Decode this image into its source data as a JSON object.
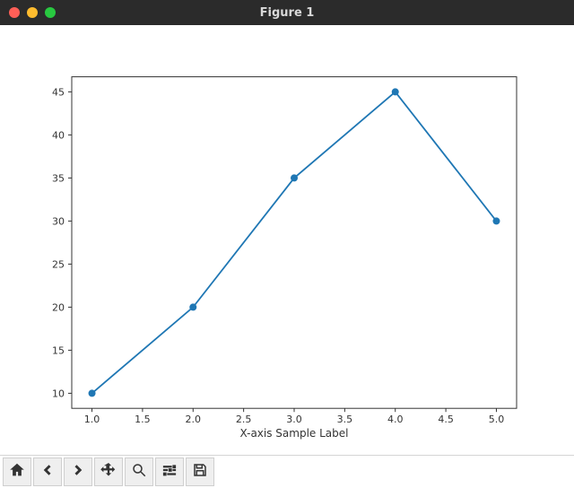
{
  "window": {
    "title": "Figure 1"
  },
  "toolbar": {
    "home": "Home",
    "back": "Back",
    "forward": "Forward",
    "pan": "Pan",
    "zoom": "Zoom",
    "config": "Configure subplots",
    "save": "Save"
  },
  "chart_data": {
    "type": "line",
    "x": [
      1.0,
      2.0,
      3.0,
      4.0,
      5.0
    ],
    "y": [
      10,
      20,
      35,
      45,
      30
    ],
    "xlabel": "X-axis Sample Label",
    "ylabel": "",
    "title": "",
    "xlim": [
      0.8,
      5.2
    ],
    "ylim": [
      8.25,
      46.75
    ],
    "xticks": [
      1.0,
      1.5,
      2.0,
      2.5,
      3.0,
      3.5,
      4.0,
      4.5,
      5.0
    ],
    "yticks": [
      10,
      15,
      20,
      25,
      30,
      35,
      40,
      45
    ],
    "xtick_labels": [
      "1.0",
      "1.5",
      "2.0",
      "2.5",
      "3.0",
      "3.5",
      "4.0",
      "4.5",
      "5.0"
    ],
    "ytick_labels": [
      "10",
      "15",
      "20",
      "25",
      "30",
      "35",
      "40",
      "45"
    ],
    "line_color": "#1f77b4",
    "marker_color": "#1f77b4",
    "marker_size": 6
  }
}
